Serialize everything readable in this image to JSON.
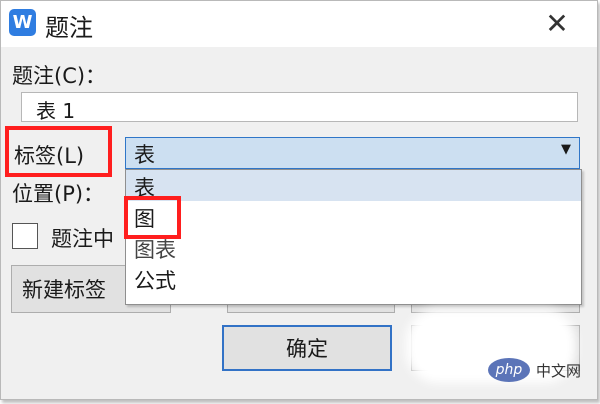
{
  "dialog": {
    "title": "题注",
    "app_icon": "wps-writer-icon",
    "close_glyph": "✕"
  },
  "caption": {
    "label": "题注(C)：",
    "value": "表 1"
  },
  "label_field": {
    "label": "标签(L)",
    "selected": "表",
    "options": [
      "表",
      "图",
      "图表",
      "公式"
    ]
  },
  "position_field": {
    "label": "位置(P)："
  },
  "exclude_checkbox": {
    "label": "题注中",
    "checked": false
  },
  "buttons": {
    "new_label": "新建标签",
    "ok": "确定"
  },
  "watermark": {
    "logo": "php",
    "text": "中文网"
  },
  "colors": {
    "highlight": "#ff1e1e",
    "accent": "#2f76c8",
    "selection": "#ccdff1"
  }
}
